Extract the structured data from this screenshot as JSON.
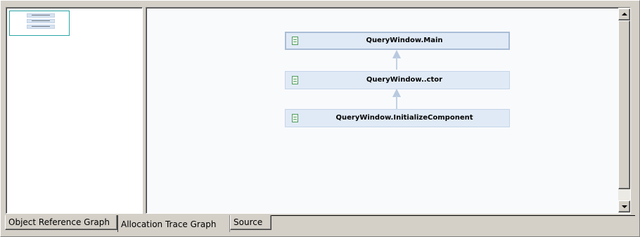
{
  "graph": {
    "nodes": [
      {
        "label": "QueryWindow.Main",
        "selected": true
      },
      {
        "label": "QueryWindow..ctor",
        "selected": false
      },
      {
        "label": "QueryWindow.InitializeComponent",
        "selected": false
      }
    ]
  },
  "tabs": [
    {
      "label": "Object Reference Graph",
      "active": false
    },
    {
      "label": "Allocation Trace Graph",
      "active": true
    },
    {
      "label": "Source",
      "active": false
    }
  ],
  "colors": {
    "node_fill": "#e0eaf6",
    "node_border": "#c5d5e9",
    "connector": "#b8c9df",
    "overview_highlight": "#2aa6a6"
  }
}
